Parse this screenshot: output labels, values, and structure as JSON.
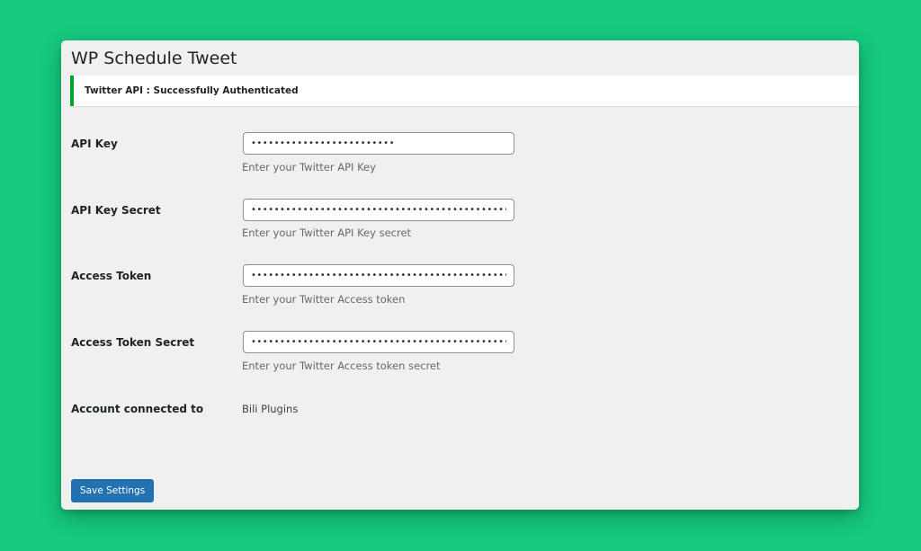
{
  "page": {
    "title": "WP Schedule Tweet"
  },
  "notice": {
    "message": "Twitter API : Successfully Authenticated",
    "color": "#00a32a"
  },
  "fields": {
    "api_key": {
      "label": "API Key",
      "value": "•••••••••••••••••••••••••",
      "description": "Enter your Twitter API Key"
    },
    "api_key_secret": {
      "label": "API Key Secret",
      "value": "••••••••••••••••••••••••••••••••••••••••••••••••••",
      "description": "Enter your Twitter API Key secret"
    },
    "access_token": {
      "label": "Access Token",
      "value": "••••••••••••••••••••••••••••••••••••••••••••••••••",
      "description": "Enter your Twitter Access token"
    },
    "access_token_secret": {
      "label": "Access Token Secret",
      "value": "•••••••••••••••••••••••••••••••••••••••••••••",
      "description": "Enter your Twitter Access token secret"
    }
  },
  "account": {
    "label": "Account connected to",
    "value": "Bili Plugins"
  },
  "actions": {
    "save_label": "Save Settings"
  },
  "colors": {
    "background": "#16c97f",
    "panel": "#f0f0f1",
    "primary": "#2271b1"
  }
}
